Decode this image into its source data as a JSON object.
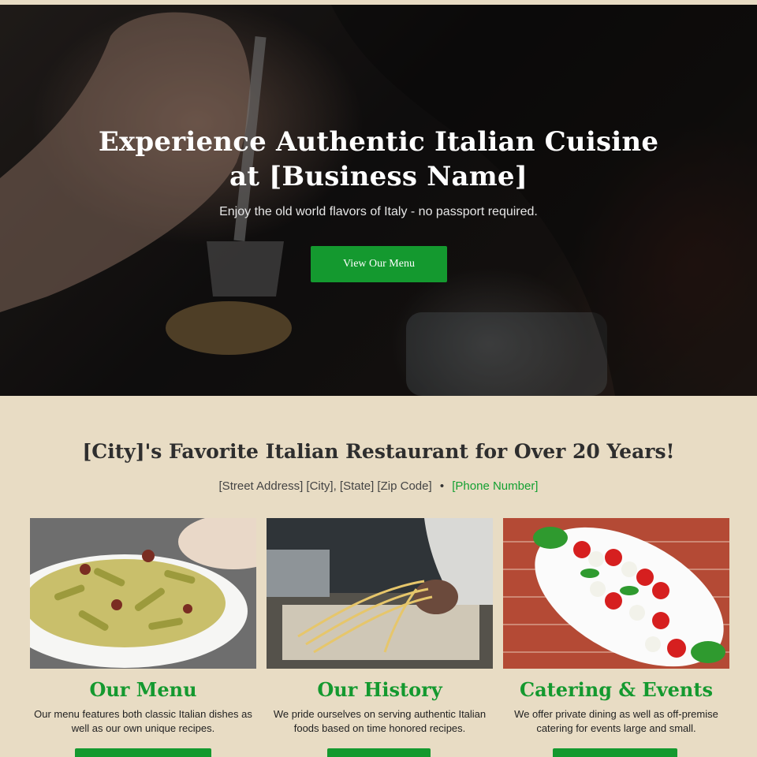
{
  "hero": {
    "title_line1": "Experience Authentic Italian Cuisine",
    "title_line2": "at [Business Name]",
    "subtitle": "Enjoy the old world flavors of Italy - no passport required.",
    "button_label": "View Our Menu"
  },
  "intro": {
    "title": "[City]'s Favorite Italian Restaurant for Over 20 Years!",
    "address": "[Street Address] [City], [State] [Zip Code]",
    "separator": "•",
    "phone": "[Phone Number]"
  },
  "cards": [
    {
      "title": "Our Menu",
      "text": "Our menu features both classic Italian dishes as well as our own unique recipes."
    },
    {
      "title": "Our History",
      "text": "We pride ourselves on serving authentic Italian foods based on time honored recipes."
    },
    {
      "title": "Catering & Events",
      "text": "We offer private dining as well as off-premise catering for events large and small."
    }
  ],
  "colors": {
    "accent_green": "#14992f",
    "paper_background": "#e8dcc4",
    "heading_dark": "#2e2e2e"
  }
}
